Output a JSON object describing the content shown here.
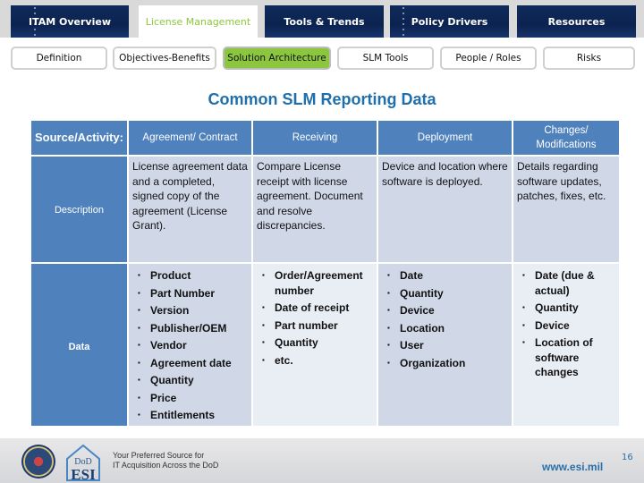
{
  "top_tabs": [
    {
      "label": "ITAM Overview",
      "active": false
    },
    {
      "label": "License Management",
      "active": true
    },
    {
      "label": "Tools & Trends",
      "active": false
    },
    {
      "label": "Policy Drivers",
      "active": false
    },
    {
      "label": "Resources",
      "active": false
    }
  ],
  "sub_nav": [
    {
      "label": "Definition",
      "active": false
    },
    {
      "label": "Objectives-Benefits",
      "active": false
    },
    {
      "label": "Solution Architecture",
      "active": true
    },
    {
      "label": "SLM Tools",
      "active": false
    },
    {
      "label": "People / Roles",
      "active": false
    },
    {
      "label": "Risks",
      "active": false
    }
  ],
  "title": "Common SLM Reporting Data",
  "table": {
    "headers": [
      "Source/Activity:",
      "Agreement/ Contract",
      "Receiving",
      "Deployment",
      "Changes/ Modifications"
    ],
    "description_row": {
      "label": "Description",
      "cells": [
        "License agreement data and a completed, signed copy of the agreement (License Grant).",
        "Compare License receipt with license agreement. Document and resolve discrepancies.",
        "Device and location where software is deployed.",
        "Details regarding software updates, patches, fixes, etc."
      ]
    },
    "data_row": {
      "label": "Data",
      "cells": [
        [
          "Product",
          "Part Number",
          "Version",
          "Publisher/OEM",
          "Vendor",
          "Agreement date",
          "Quantity",
          "Price",
          "Entitlements"
        ],
        [
          "Order/Agreement number",
          "Date of receipt",
          "Part number",
          "Quantity",
          "etc."
        ],
        [
          "Date",
          "Quantity",
          "Device",
          "Location",
          "User",
          "Organization"
        ],
        [
          "Date (due & actual)",
          "Quantity",
          "Device",
          "Location of software changes"
        ]
      ]
    }
  },
  "footer": {
    "logo_text_top": "DoD",
    "logo_text_bottom": "ESI",
    "tagline_line1": "Your Preferred Source for",
    "tagline_line2": "IT Acquisition Across the DoD",
    "url": "www.esi.mil",
    "page_number": "16"
  },
  "colors": {
    "header_blue": "#4f81bd",
    "active_green": "#8cc63f",
    "nav_navy": "#0c2350",
    "title_blue": "#1f6fad"
  }
}
